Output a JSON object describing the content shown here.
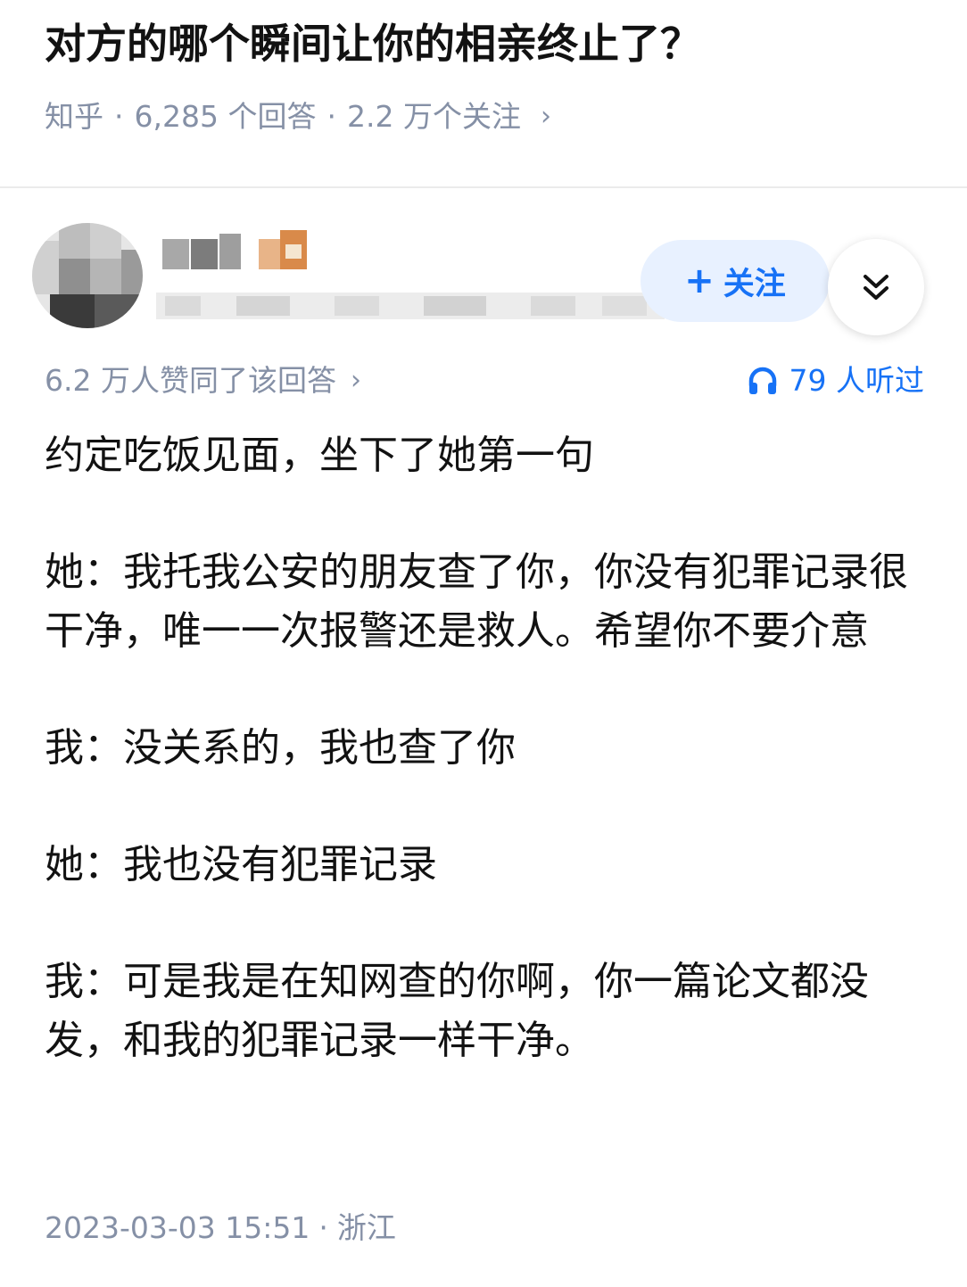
{
  "question": {
    "title": "对方的哪个瞬间让你的相亲终止了？",
    "source": "知乎",
    "answers": "6,285 个回答",
    "followers": "2.2 万个关注",
    "chevron": "›"
  },
  "author": {
    "follow_plus": "+",
    "follow_label": "关注",
    "expand_icon": "double-chevron-down-icon"
  },
  "answer": {
    "votes": "6.2 万人赞同了该回答",
    "votes_chevron": "›",
    "listen_icon": "headphones-icon",
    "listen": "79 人听过",
    "paragraphs": [
      "约定吃饭见面，坐下了她第一句",
      "她：我托我公安的朋友查了你，你没有犯罪记录很干净，唯一一次报警还是救人。希望你不要介意",
      "我：没关系的，我也查了你",
      "她：我也没有犯罪记录",
      "我：可是我是在知网查的你啊，你一篇论文都没发，和我的犯罪记录一样干净。"
    ],
    "timestamp": "2023-03-03 15:51",
    "dot": "·",
    "location": "浙江"
  },
  "colors": {
    "accent": "#1772f6",
    "meta_gray": "#8590a6",
    "follow_bg": "#e8f1ff"
  }
}
